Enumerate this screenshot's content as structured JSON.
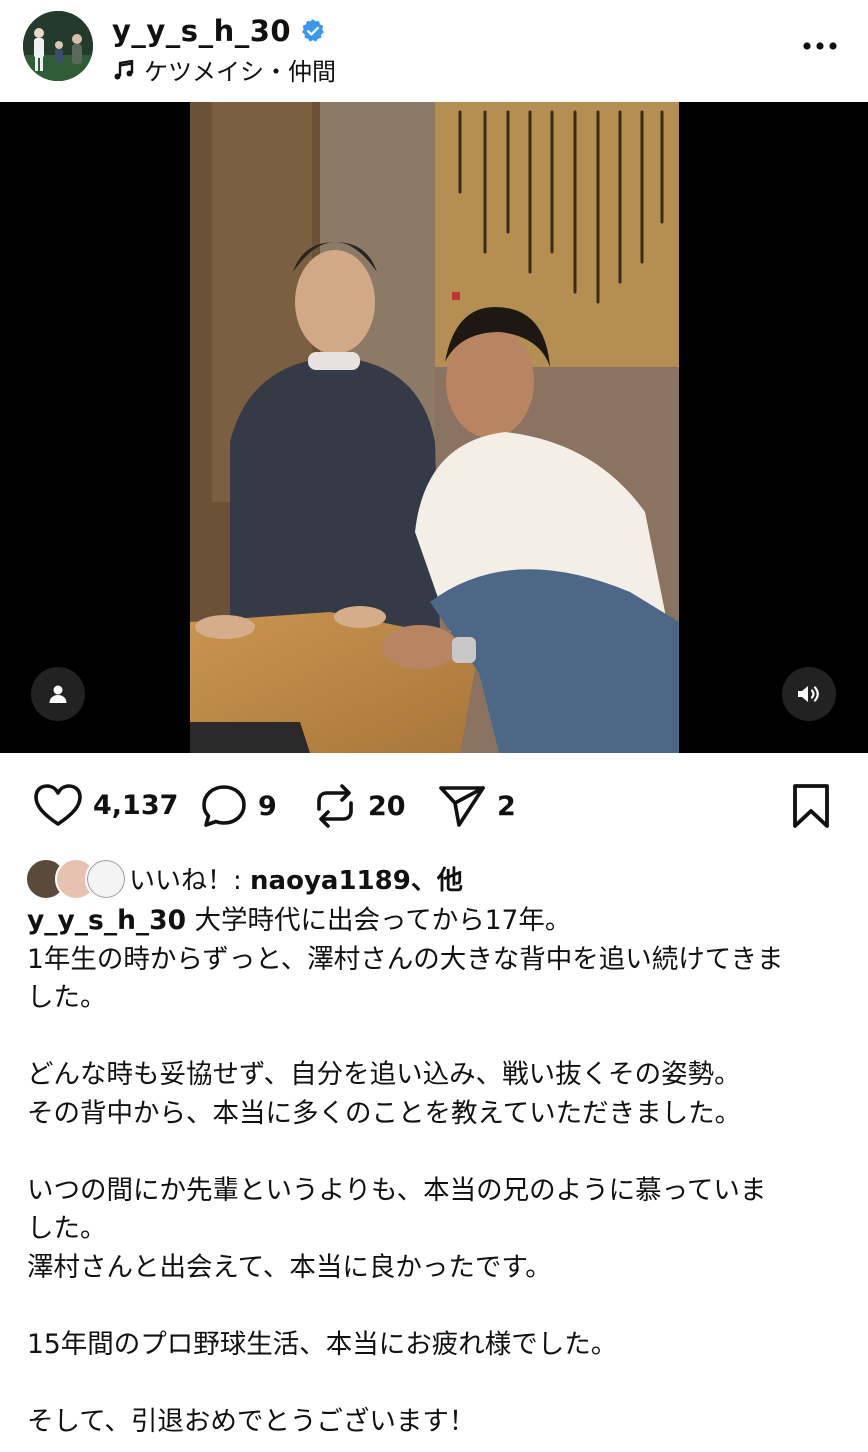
{
  "post": {
    "username": "y_y_s_h_30",
    "music_label": "ケツメイシ・仲間"
  },
  "actions": {
    "likes_count": "4,137",
    "comments_count": "9",
    "reposts_count": "20",
    "shares_count": "2"
  },
  "liked_by": {
    "prefix": "いいね！: ",
    "user": "naoya1189",
    "suffix": "、他"
  },
  "caption": {
    "username": "y_y_s_h_30",
    "lines": [
      "大学時代に出会ってから17年。",
      "1年生の時からずっと、澤村さんの大きな背中を追い続けてきま",
      "した。",
      "",
      "どんな時も妥協せず、自分を追い込み、戦い抜くその姿勢。",
      "その背中から、本当に多くのことを教えていただきました。",
      "",
      "いつの間にか先輩というよりも、本当の兄のように慕っていま",
      "した。",
      "澤村さんと出会えて、本当に良かったです。",
      "",
      "15年間のプロ野球生活、本当にお疲れ様でした。",
      "",
      "そして、引退おめでとうございます！"
    ]
  },
  "icons": {
    "verified": "verified-badge-icon",
    "music": "music-note-icon",
    "more": "more-horizontal-icon",
    "user_tag": "user-tag-icon",
    "sound": "speaker-icon",
    "like": "heart-icon",
    "comment": "comment-icon",
    "repost": "repost-icon",
    "share": "send-icon",
    "save": "bookmark-icon"
  },
  "colors": {
    "verified_blue": "#3897f0",
    "text": "#111111",
    "media_bg": "#000000"
  }
}
